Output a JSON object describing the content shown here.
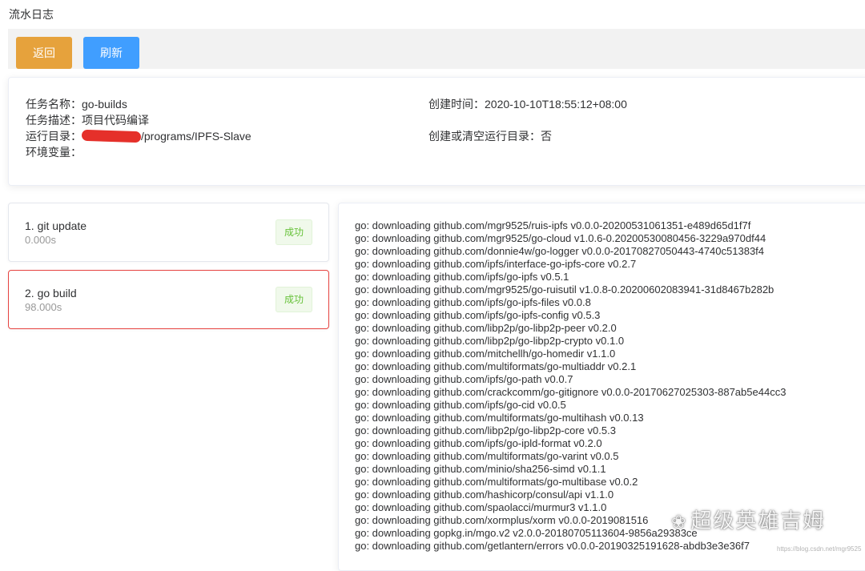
{
  "page": {
    "title": "流水日志"
  },
  "toolbar": {
    "back_label": "返回",
    "refresh_label": "刷新"
  },
  "info": {
    "task_name_label": "任务名称：",
    "task_name_value": "go-builds",
    "task_desc_label": "任务描述：",
    "task_desc_value": "项目代码编译",
    "run_dir_label": "运行目录：",
    "run_dir_value": "/programs/IPFS-Slave",
    "env_label": "环境变量：",
    "created_label": "创建时间：",
    "created_value": "2020-10-10T18:55:12+08:00",
    "clear_dir_label": "创建或清空运行目录：",
    "clear_dir_value": "否"
  },
  "steps": [
    {
      "name": "1. git update",
      "time": "0.000s",
      "status": "成功",
      "active": false
    },
    {
      "name": "2. go build",
      "time": "98.000s",
      "status": "成功",
      "active": true
    }
  ],
  "log": {
    "lines": [
      "go: downloading github.com/mgr9525/ruis-ipfs v0.0.0-20200531061351-e489d65d1f7f",
      "go: downloading github.com/mgr9525/go-cloud v1.0.6-0.20200530080456-3229a970df44",
      "go: downloading github.com/donnie4w/go-logger v0.0.0-20170827050443-4740c51383f4",
      "go: downloading github.com/ipfs/interface-go-ipfs-core v0.2.7",
      "go: downloading github.com/ipfs/go-ipfs v0.5.1",
      "go: downloading github.com/mgr9525/go-ruisutil v1.0.8-0.20200602083941-31d8467b282b",
      "go: downloading github.com/ipfs/go-ipfs-files v0.0.8",
      "go: downloading github.com/ipfs/go-ipfs-config v0.5.3",
      "go: downloading github.com/libp2p/go-libp2p-peer v0.2.0",
      "go: downloading github.com/libp2p/go-libp2p-crypto v0.1.0",
      "go: downloading github.com/mitchellh/go-homedir v1.1.0",
      "go: downloading github.com/multiformats/go-multiaddr v0.2.1",
      "go: downloading github.com/ipfs/go-path v0.0.7",
      "go: downloading github.com/crackcomm/go-gitignore v0.0.0-20170627025303-887ab5e44cc3",
      "go: downloading github.com/ipfs/go-cid v0.0.5",
      "go: downloading github.com/multiformats/go-multihash v0.0.13",
      "go: downloading github.com/libp2p/go-libp2p-core v0.5.3",
      "go: downloading github.com/ipfs/go-ipld-format v0.2.0",
      "go: downloading github.com/multiformats/go-varint v0.0.5",
      "go: downloading github.com/minio/sha256-simd v0.1.1",
      "go: downloading github.com/multiformats/go-multibase v0.0.2",
      "go: downloading github.com/hashicorp/consul/api v1.1.0",
      "go: downloading github.com/spaolacci/murmur3 v1.1.0",
      "go: downloading github.com/xormplus/xorm v0.0.0-2019081516",
      "go: downloading gopkg.in/mgo.v2 v2.0.0-20180705113604-9856a29383ce",
      "go: downloading github.com/getlantern/errors v0.0.0-20190325191628-abdb3e3e36f7"
    ]
  },
  "watermark": {
    "icon": "wechat-icon",
    "text": "超级英雄吉姆",
    "url": "https://blog.csdn.net/mgr9525"
  }
}
